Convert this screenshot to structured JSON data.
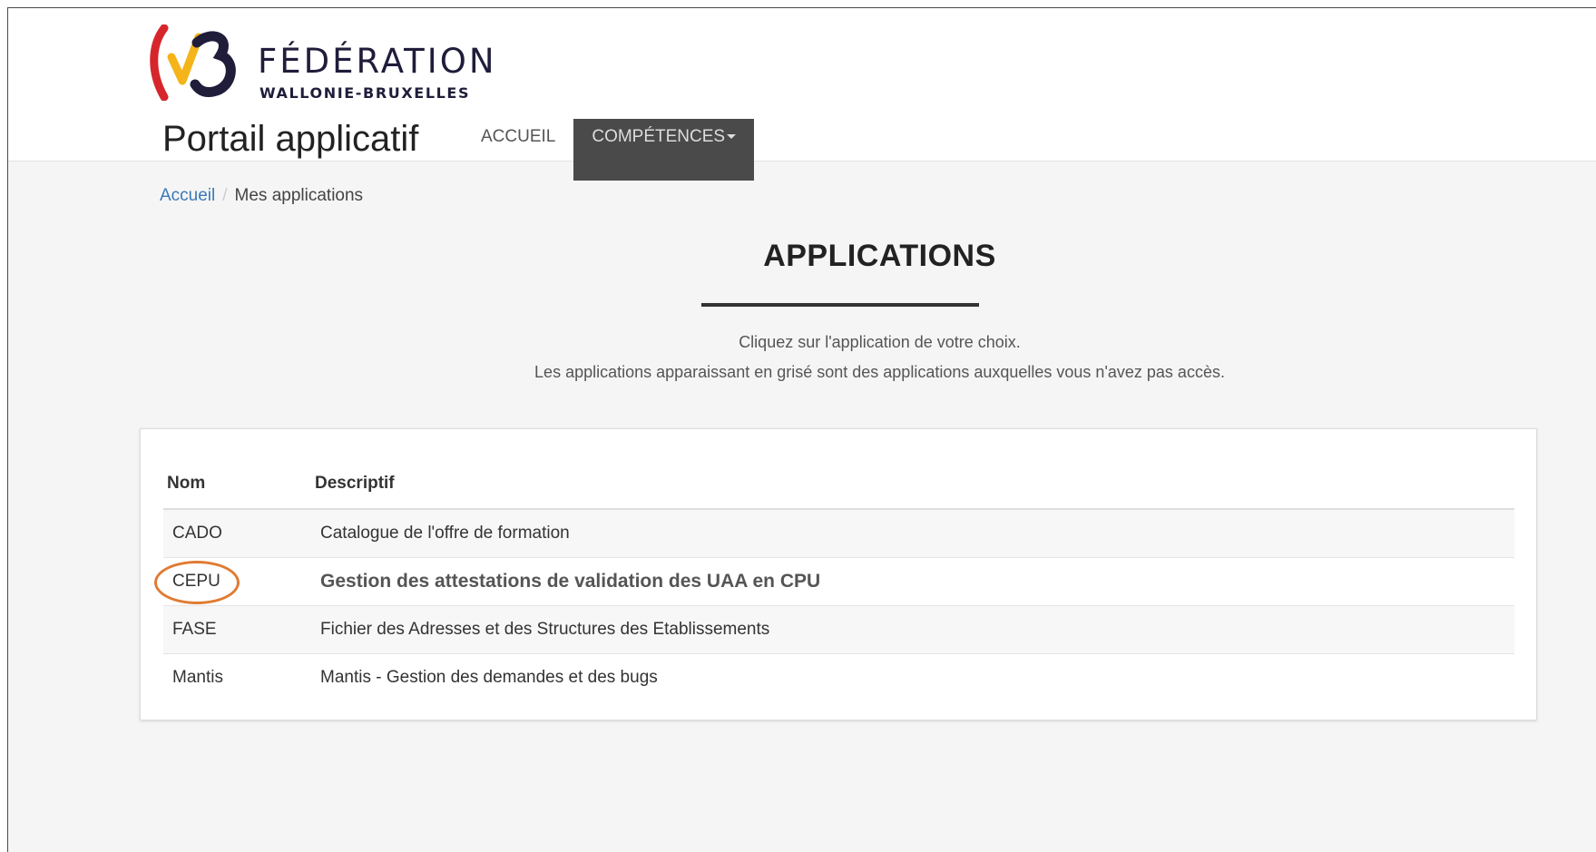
{
  "brand": {
    "name": "FÉDÉRATION",
    "subtitle": "WALLONIE-BRUXELLES",
    "colors": {
      "red": "#d6262c",
      "yellow": "#f4b41a",
      "navy": "#1f1d3a"
    }
  },
  "header": {
    "portal_title": "Portail applicatif",
    "nav": [
      {
        "label": "ACCUEIL",
        "active": false
      },
      {
        "label": "COMPÉTENCES",
        "active": true,
        "has_dropdown": true
      }
    ]
  },
  "breadcrumb": {
    "home": "Accueil",
    "separator": "/",
    "current": "Mes applications"
  },
  "page": {
    "heading": "APPLICATIONS",
    "intro_line1": "Cliquez sur l'application de votre choix.",
    "intro_line2": "Les applications apparaissant en grisé sont des applications auxquelles vous n'avez pas accès."
  },
  "table": {
    "columns": [
      "Nom",
      "Descriptif"
    ],
    "rows": [
      {
        "name": "CADO",
        "description": "Catalogue de l'offre de formation"
      },
      {
        "name": "CEPU",
        "description": "Gestion des attestations de validation des UAA en CPU",
        "highlighted": true
      },
      {
        "name": "FASE",
        "description": "Fichier des Adresses et des Structures des Etablissements"
      },
      {
        "name": "Mantis",
        "description": "Mantis - Gestion des demandes et des bugs"
      }
    ]
  },
  "annotation": {
    "ring_color": "#e07b32"
  }
}
